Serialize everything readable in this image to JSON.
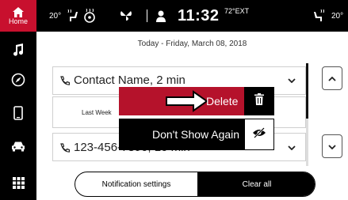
{
  "sidebar": {
    "home_label": "Home",
    "items": [
      {
        "icon": "home-icon"
      },
      {
        "icon": "music-note-icon"
      },
      {
        "icon": "compass-icon"
      },
      {
        "icon": "phone-icon"
      },
      {
        "icon": "car-icon"
      },
      {
        "icon": "apps-grid-icon"
      }
    ]
  },
  "statusbar": {
    "left_temp": "20°",
    "time": "11:32",
    "ext_temp": "72°EXT",
    "right_temp": "20°"
  },
  "date_line": "Today - Friday, March 08, 2018",
  "notifications": [
    {
      "title": "Contact Name, 2 min",
      "subtitle": "Last Week"
    },
    {
      "title": "123-456-7890, 10 min"
    }
  ],
  "menu": {
    "delete_label": "Delete",
    "dont_show_label": "Don't Show Again"
  },
  "footer": {
    "settings_label": "Notification settings",
    "clear_label": "Clear all"
  },
  "colors": {
    "accent_red": "#b5122b",
    "home_red": "#c8102e",
    "bar_black": "#000000"
  }
}
